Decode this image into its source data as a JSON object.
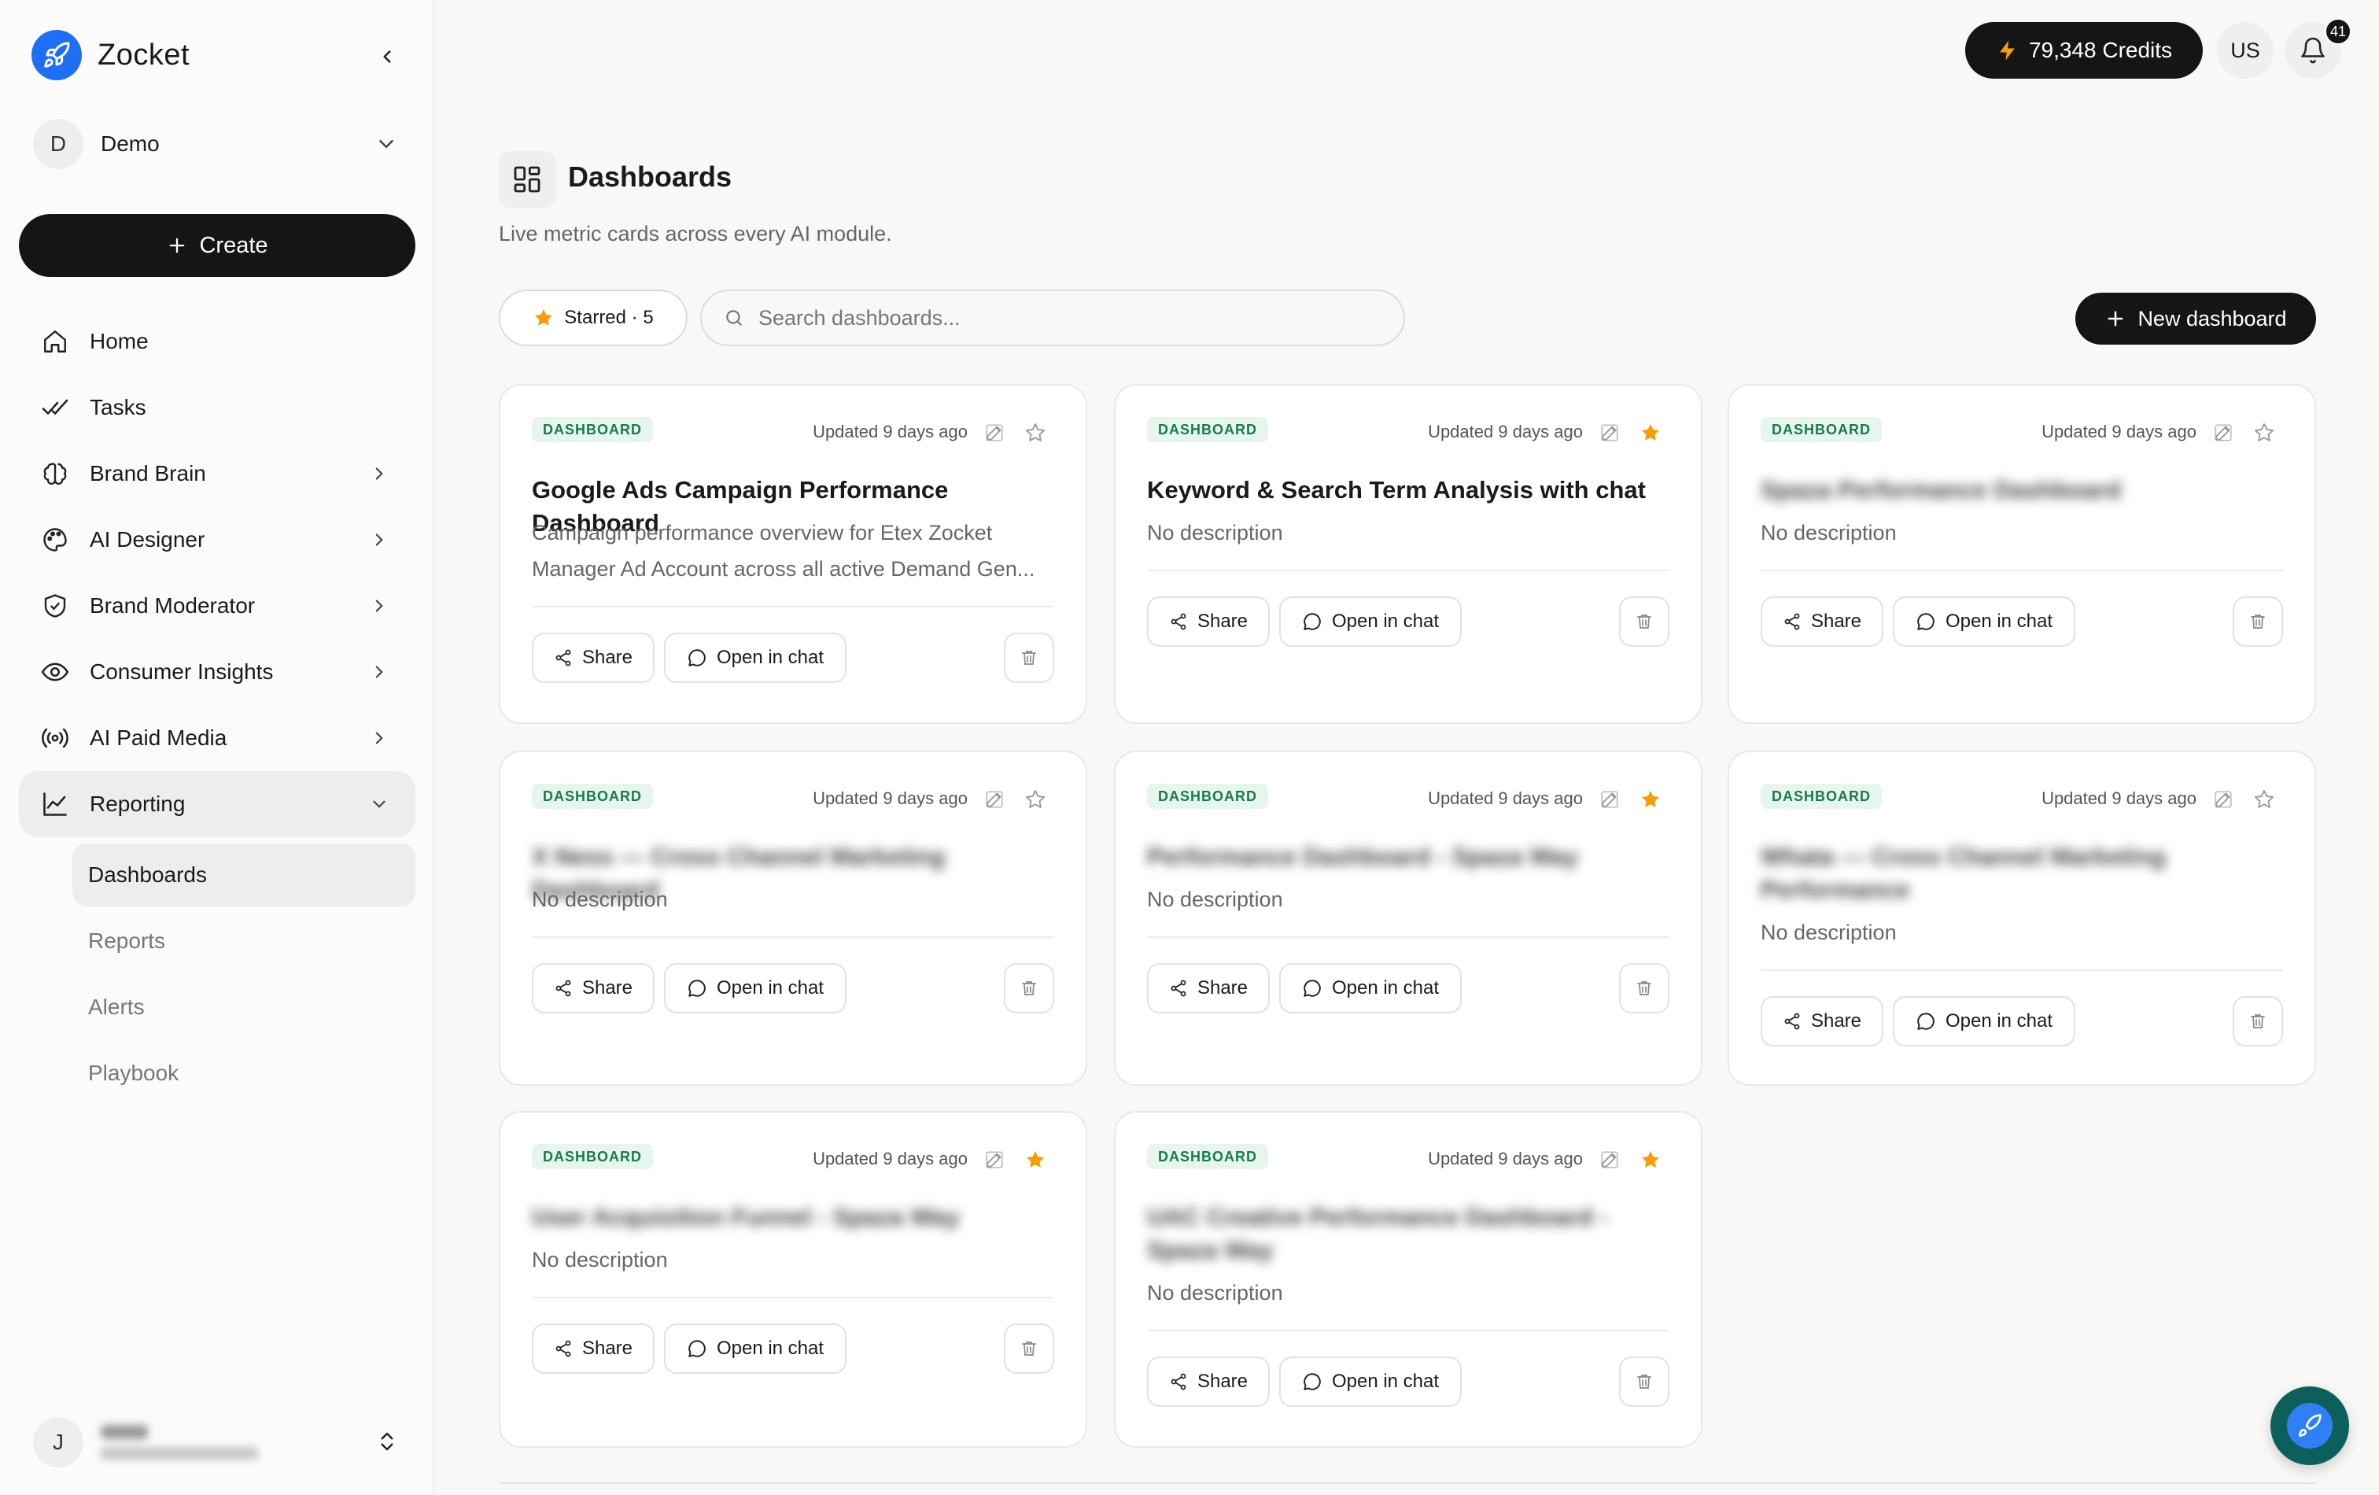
{
  "app": {
    "name": "Zocket"
  },
  "workspace": {
    "initial": "D",
    "name": "Demo"
  },
  "sidebar": {
    "create_label": "Create",
    "items": [
      {
        "label": "Home",
        "icon": "home-icon"
      },
      {
        "label": "Tasks",
        "icon": "tasks-icon"
      },
      {
        "label": "Brand Brain",
        "icon": "brain-icon"
      },
      {
        "label": "AI Designer",
        "icon": "palette-icon"
      },
      {
        "label": "Brand Moderator",
        "icon": "shield-icon"
      },
      {
        "label": "Consumer Insights",
        "icon": "eye-icon"
      },
      {
        "label": "AI Paid Media",
        "icon": "broadcast-icon"
      },
      {
        "label": "Reporting",
        "icon": "chart-line-icon"
      }
    ],
    "reporting_sub": [
      "Dashboards",
      "Reports",
      "Alerts",
      "Playbook"
    ]
  },
  "user": {
    "initial": "J"
  },
  "topbar": {
    "credits": "79,348 Credits",
    "region": "US",
    "notifications": "41"
  },
  "page": {
    "title": "Dashboards",
    "subtitle": "Live metric cards across every AI module.",
    "starred_filter": "Starred · 5",
    "search_placeholder": "Search dashboards...",
    "new_button": "New dashboard"
  },
  "card_labels": {
    "badge": "DASHBOARD",
    "share": "Share",
    "open_chat": "Open in chat"
  },
  "cards": [
    {
      "updated": "Updated 9 days ago",
      "title": "Google Ads Campaign Performance Dashboard",
      "description": "Campaign performance overview for Etex Zocket Manager Ad Account across all active Demand Gen...",
      "starred": false,
      "blurred": false
    },
    {
      "updated": "Updated 9 days ago",
      "title": "Keyword & Search Term Analysis with chat",
      "description": "No description",
      "starred": true,
      "blurred": false
    },
    {
      "updated": "Updated 9 days ago",
      "title": "Spaza Performance Dashboard",
      "description": "No description",
      "starred": false,
      "blurred": true
    },
    {
      "updated": "Updated 9 days ago",
      "title": "X Ness — Cross Channel Marketing Dashboard",
      "description": "No description",
      "starred": false,
      "blurred": true
    },
    {
      "updated": "Updated 9 days ago",
      "title": "Performance Dashboard - Spaza Way",
      "description": "No description",
      "starred": true,
      "blurred": true
    },
    {
      "updated": "Updated 9 days ago",
      "title": "Whata — Cross Channel Marketing Performance",
      "description": "No description",
      "starred": false,
      "blurred": true
    },
    {
      "updated": "Updated 9 days ago",
      "title": "User Acquisition Funnel - Spaza Way",
      "description": "No description",
      "starred": true,
      "blurred": true
    },
    {
      "updated": "Updated 9 days ago",
      "title": "UAC Creative Performance Dashboard - Spaza Way",
      "description": "No description",
      "starred": true,
      "blurred": true
    }
  ],
  "colors": {
    "accent_star": "#f59e0b",
    "badge_green": "#1a7a4c",
    "brand_blue": "#1f6ef5",
    "dark": "#151515"
  }
}
